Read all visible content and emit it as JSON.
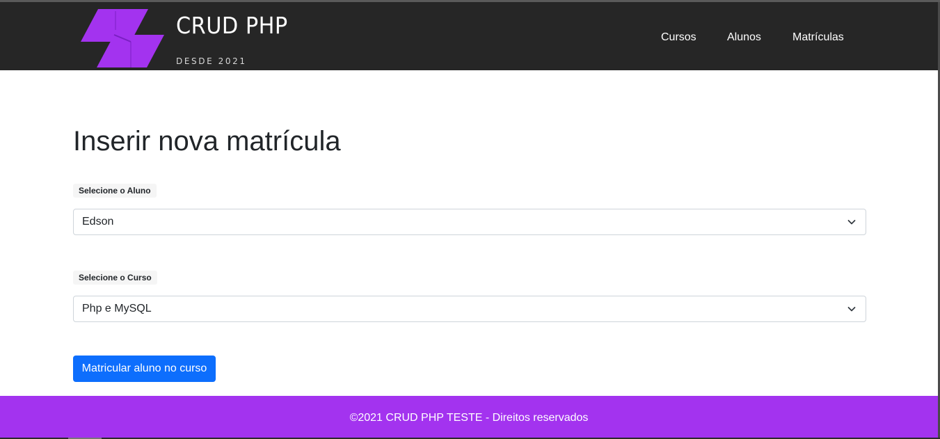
{
  "brand": {
    "title": "CRUD PHP",
    "subtitle": "DESDE 2021",
    "logo_icon": "purple-parallelogram-logo",
    "logo_color": "#a333ef"
  },
  "nav": {
    "items": [
      {
        "label": "Cursos"
      },
      {
        "label": "Alunos"
      },
      {
        "label": "Matrículas"
      }
    ]
  },
  "main": {
    "title": "Inserir nova matrícula",
    "aluno": {
      "label": "Selecione o Aluno",
      "selected": "Edson"
    },
    "curso": {
      "label": "Selecione o Curso",
      "selected": "Php e MySQL"
    },
    "submit_label": "Matricular aluno no curso"
  },
  "footer": {
    "text": "©2021 CRUD PHP TESTE - Direitos reservados"
  },
  "colors": {
    "header_bg": "#262626",
    "accent": "#a333ef",
    "primary_button": "#0d6efd"
  }
}
